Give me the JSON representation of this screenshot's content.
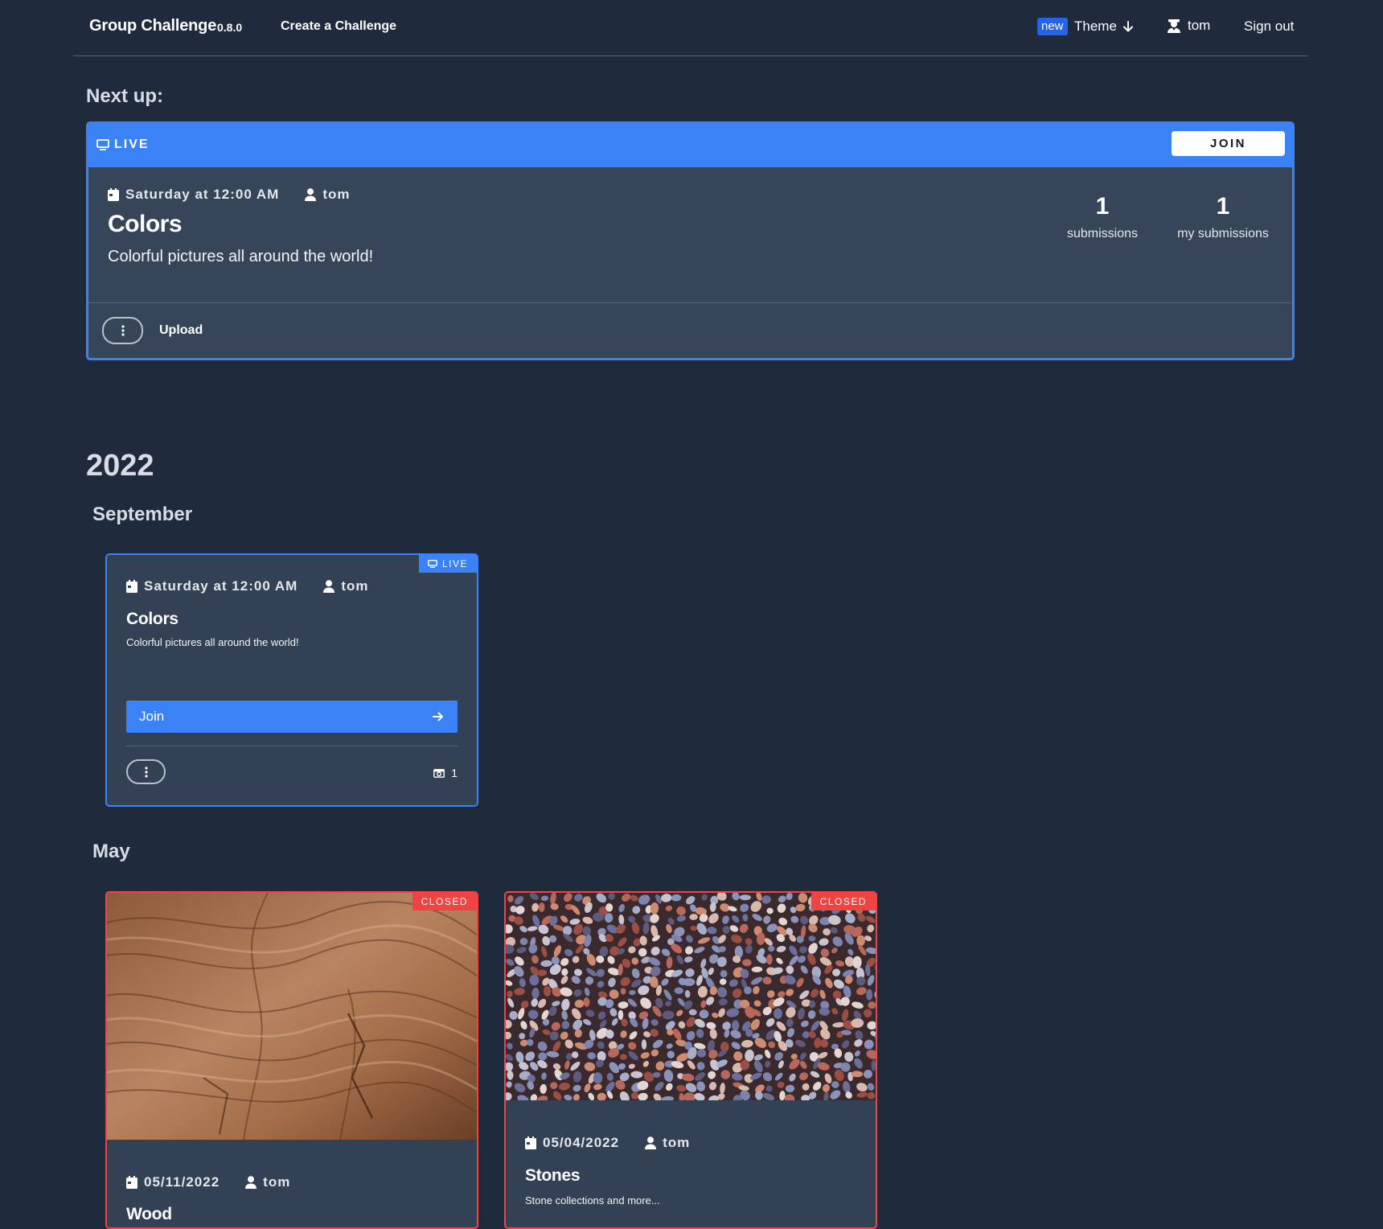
{
  "nav": {
    "brand": "Group Challenge",
    "version": "0.8.0",
    "create_link": "Create a Challenge",
    "new_badge": "new",
    "theme": "Theme",
    "user": "tom",
    "sign_out": "Sign out"
  },
  "next_up": {
    "heading": "Next up:",
    "status": "LIVE",
    "join": "JOIN",
    "date": "Saturday at 12:00 AM",
    "author": "tom",
    "title": "Colors",
    "description": "Colorful pictures all around the world!",
    "submissions": "1",
    "submissions_label": "submissions",
    "my_submissions": "1",
    "my_submissions_label": "my submissions",
    "upload": "Upload"
  },
  "year": "2022",
  "months": [
    {
      "name": "September",
      "cards": [
        {
          "status": "LIVE",
          "date": "Saturday at 12:00 AM",
          "author": "tom",
          "title": "Colors",
          "description": "Colorful pictures all around the world!",
          "join": "Join",
          "submission_count": "1"
        }
      ]
    },
    {
      "name": "May",
      "cards": [
        {
          "status": "CLOSED",
          "date": "05/11/2022",
          "author": "tom",
          "title": "Wood",
          "image": "wood-texture"
        },
        {
          "status": "CLOSED",
          "date": "05/04/2022",
          "author": "tom",
          "title": "Stones",
          "description": "Stone collections and more...",
          "image": "pebbles"
        }
      ]
    }
  ],
  "colors": {
    "background": "#1f2a3c",
    "card": "#334155",
    "accent": "#3b82f6",
    "closed": "#ef4444"
  },
  "icons": [
    "monitor-icon",
    "calendar-icon",
    "user-icon",
    "user-tie-icon",
    "arrow-down-icon",
    "arrow-right-icon",
    "kebab-icon",
    "camera-icon"
  ]
}
